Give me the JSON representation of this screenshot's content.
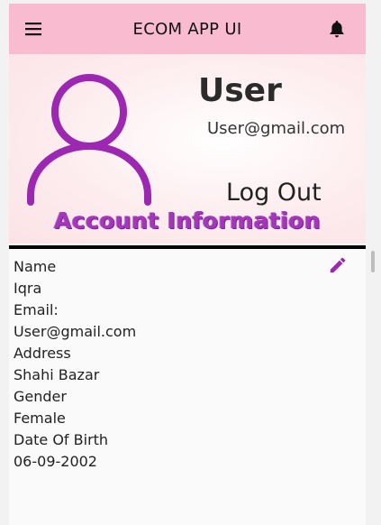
{
  "appbar": {
    "title": "ECOM APP UI",
    "menu_icon": "menu-icon",
    "bell_icon": "notification-bell-icon"
  },
  "profile": {
    "avatar_icon": "user-avatar-icon",
    "name": "User",
    "email": "User@gmail.com",
    "logout_label": "Log Out"
  },
  "account": {
    "title": "Account Information",
    "edit_icon": "edit-pencil-icon",
    "fields": [
      {
        "label": "Name",
        "value": "Iqra"
      },
      {
        "label": "Email:",
        "value": "User@gmail.com"
      },
      {
        "label": "Address",
        "value": "Shahi Bazar"
      },
      {
        "label": "Gender",
        "value": "Female"
      },
      {
        "label": "Date Of Birth",
        "value": "06-09-2002"
      }
    ]
  },
  "colors": {
    "appbar": "#f8bbd0",
    "accent_purple": "#9c27b0",
    "divider": "#000000"
  }
}
